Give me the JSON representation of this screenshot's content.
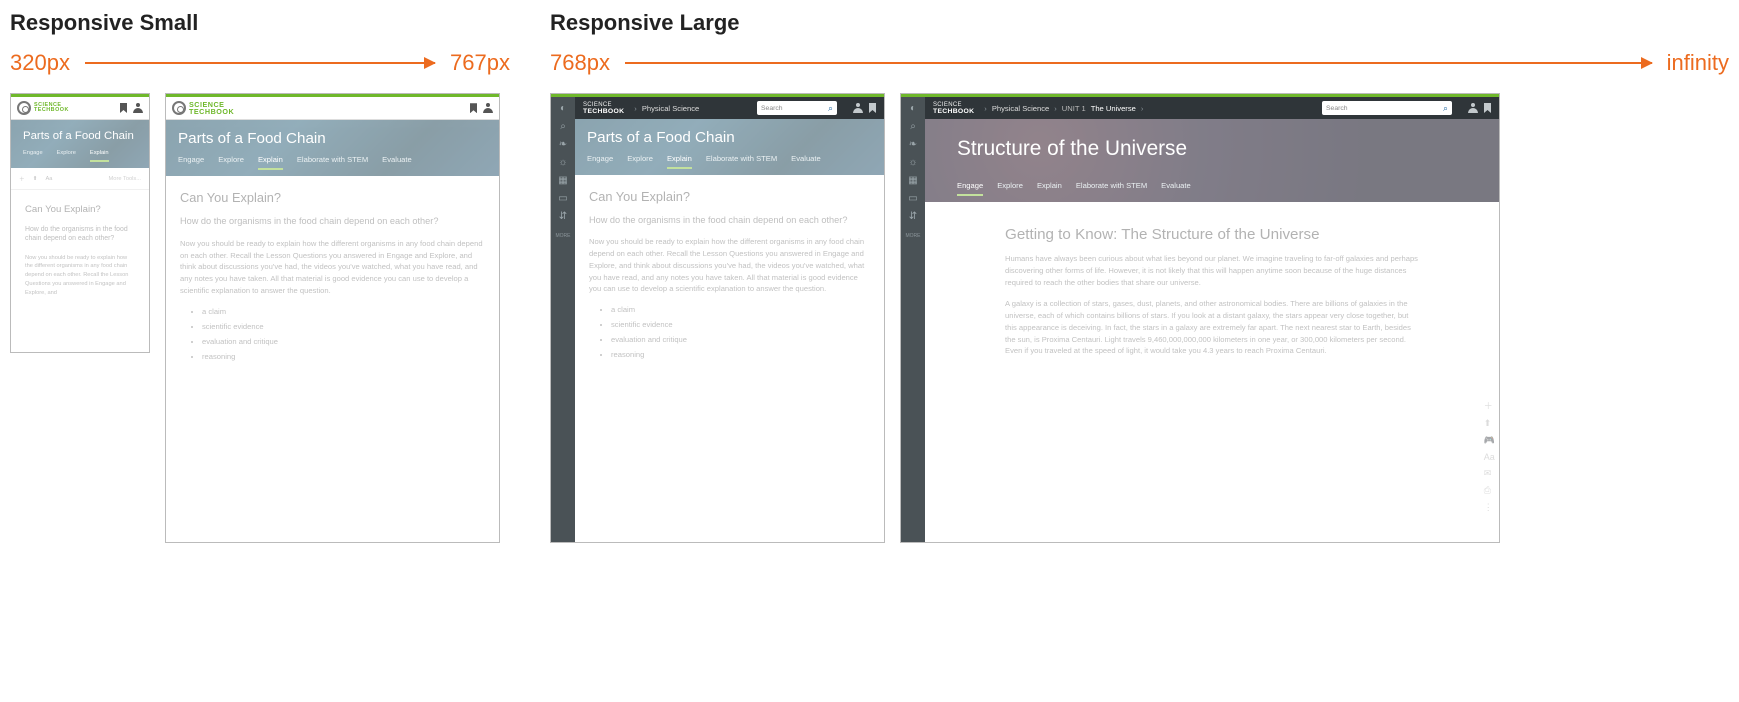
{
  "sections": {
    "small": {
      "title": "Responsive Small",
      "from": "320px",
      "to": "767px"
    },
    "large": {
      "title": "Responsive Large",
      "from": "768px",
      "to": "infinity"
    }
  },
  "brand": {
    "line1": "SCIENCE",
    "line2": "TECHBOOK"
  },
  "search": {
    "placeholder": "Search"
  },
  "breadcrumb": {
    "course": "Physical Science",
    "unit_prefix": "UNIT 1",
    "unit_title": "The Universe"
  },
  "tabs": [
    "Engage",
    "Explore",
    "Explain",
    "Elaborate with STEM",
    "Evaluate"
  ],
  "tabs_short": [
    "Engage",
    "Explore",
    "Explain"
  ],
  "toolbar": {
    "text_size": "Aa",
    "more": "More Tools..."
  },
  "sidebar_more": "MORE",
  "food_chain": {
    "hero_title": "Parts of a Food Chain",
    "h2": "Can You Explain?",
    "h3": "How do the organisms in the food chain depend on each other?",
    "p1": "Now you should be ready to explain how the different organisms in any food chain depend on each other. Recall the Lesson Questions you answered in Engage and Explore, and think about discussions you've had, the videos you've watched, what you have read, and any notes you have taken. All that material is good evidence you can use to develop a scientific explanation to answer the question.",
    "p1_short": "Now you should be ready to explain how the different organisms in any food chain depend on each other. Recall the Lesson Questions you answered in Engage and Explore, and",
    "bullets": [
      "a claim",
      "scientific evidence",
      "evaluation and critique",
      "reasoning"
    ]
  },
  "universe": {
    "hero_title": "Structure of the Universe",
    "h2": "Getting to Know: The Structure of the Universe",
    "p1": "Humans have always been curious about what lies beyond our planet. We imagine traveling to far-off galaxies and perhaps discovering other forms of life. However, it is not likely that this will happen anytime soon because of the huge distances required to reach the other bodies that share our universe.",
    "p2": "A galaxy is a collection of stars, gases, dust, planets, and other astronomical bodies. There are billions of galaxies in the universe, each of which contains billions of stars. If you look at a distant galaxy, the stars appear very close together, but this appearance is deceiving. In fact, the stars in a galaxy are extremely far apart. The next nearest star to Earth, besides the sun, is Proxima Centauri. Light travels 9,460,000,000,000 kilometers in one year, or 300,000 kilometers per second. Even if you traveled at the speed of light, it would take you 4.3 years to reach Proxima Centauri."
  }
}
